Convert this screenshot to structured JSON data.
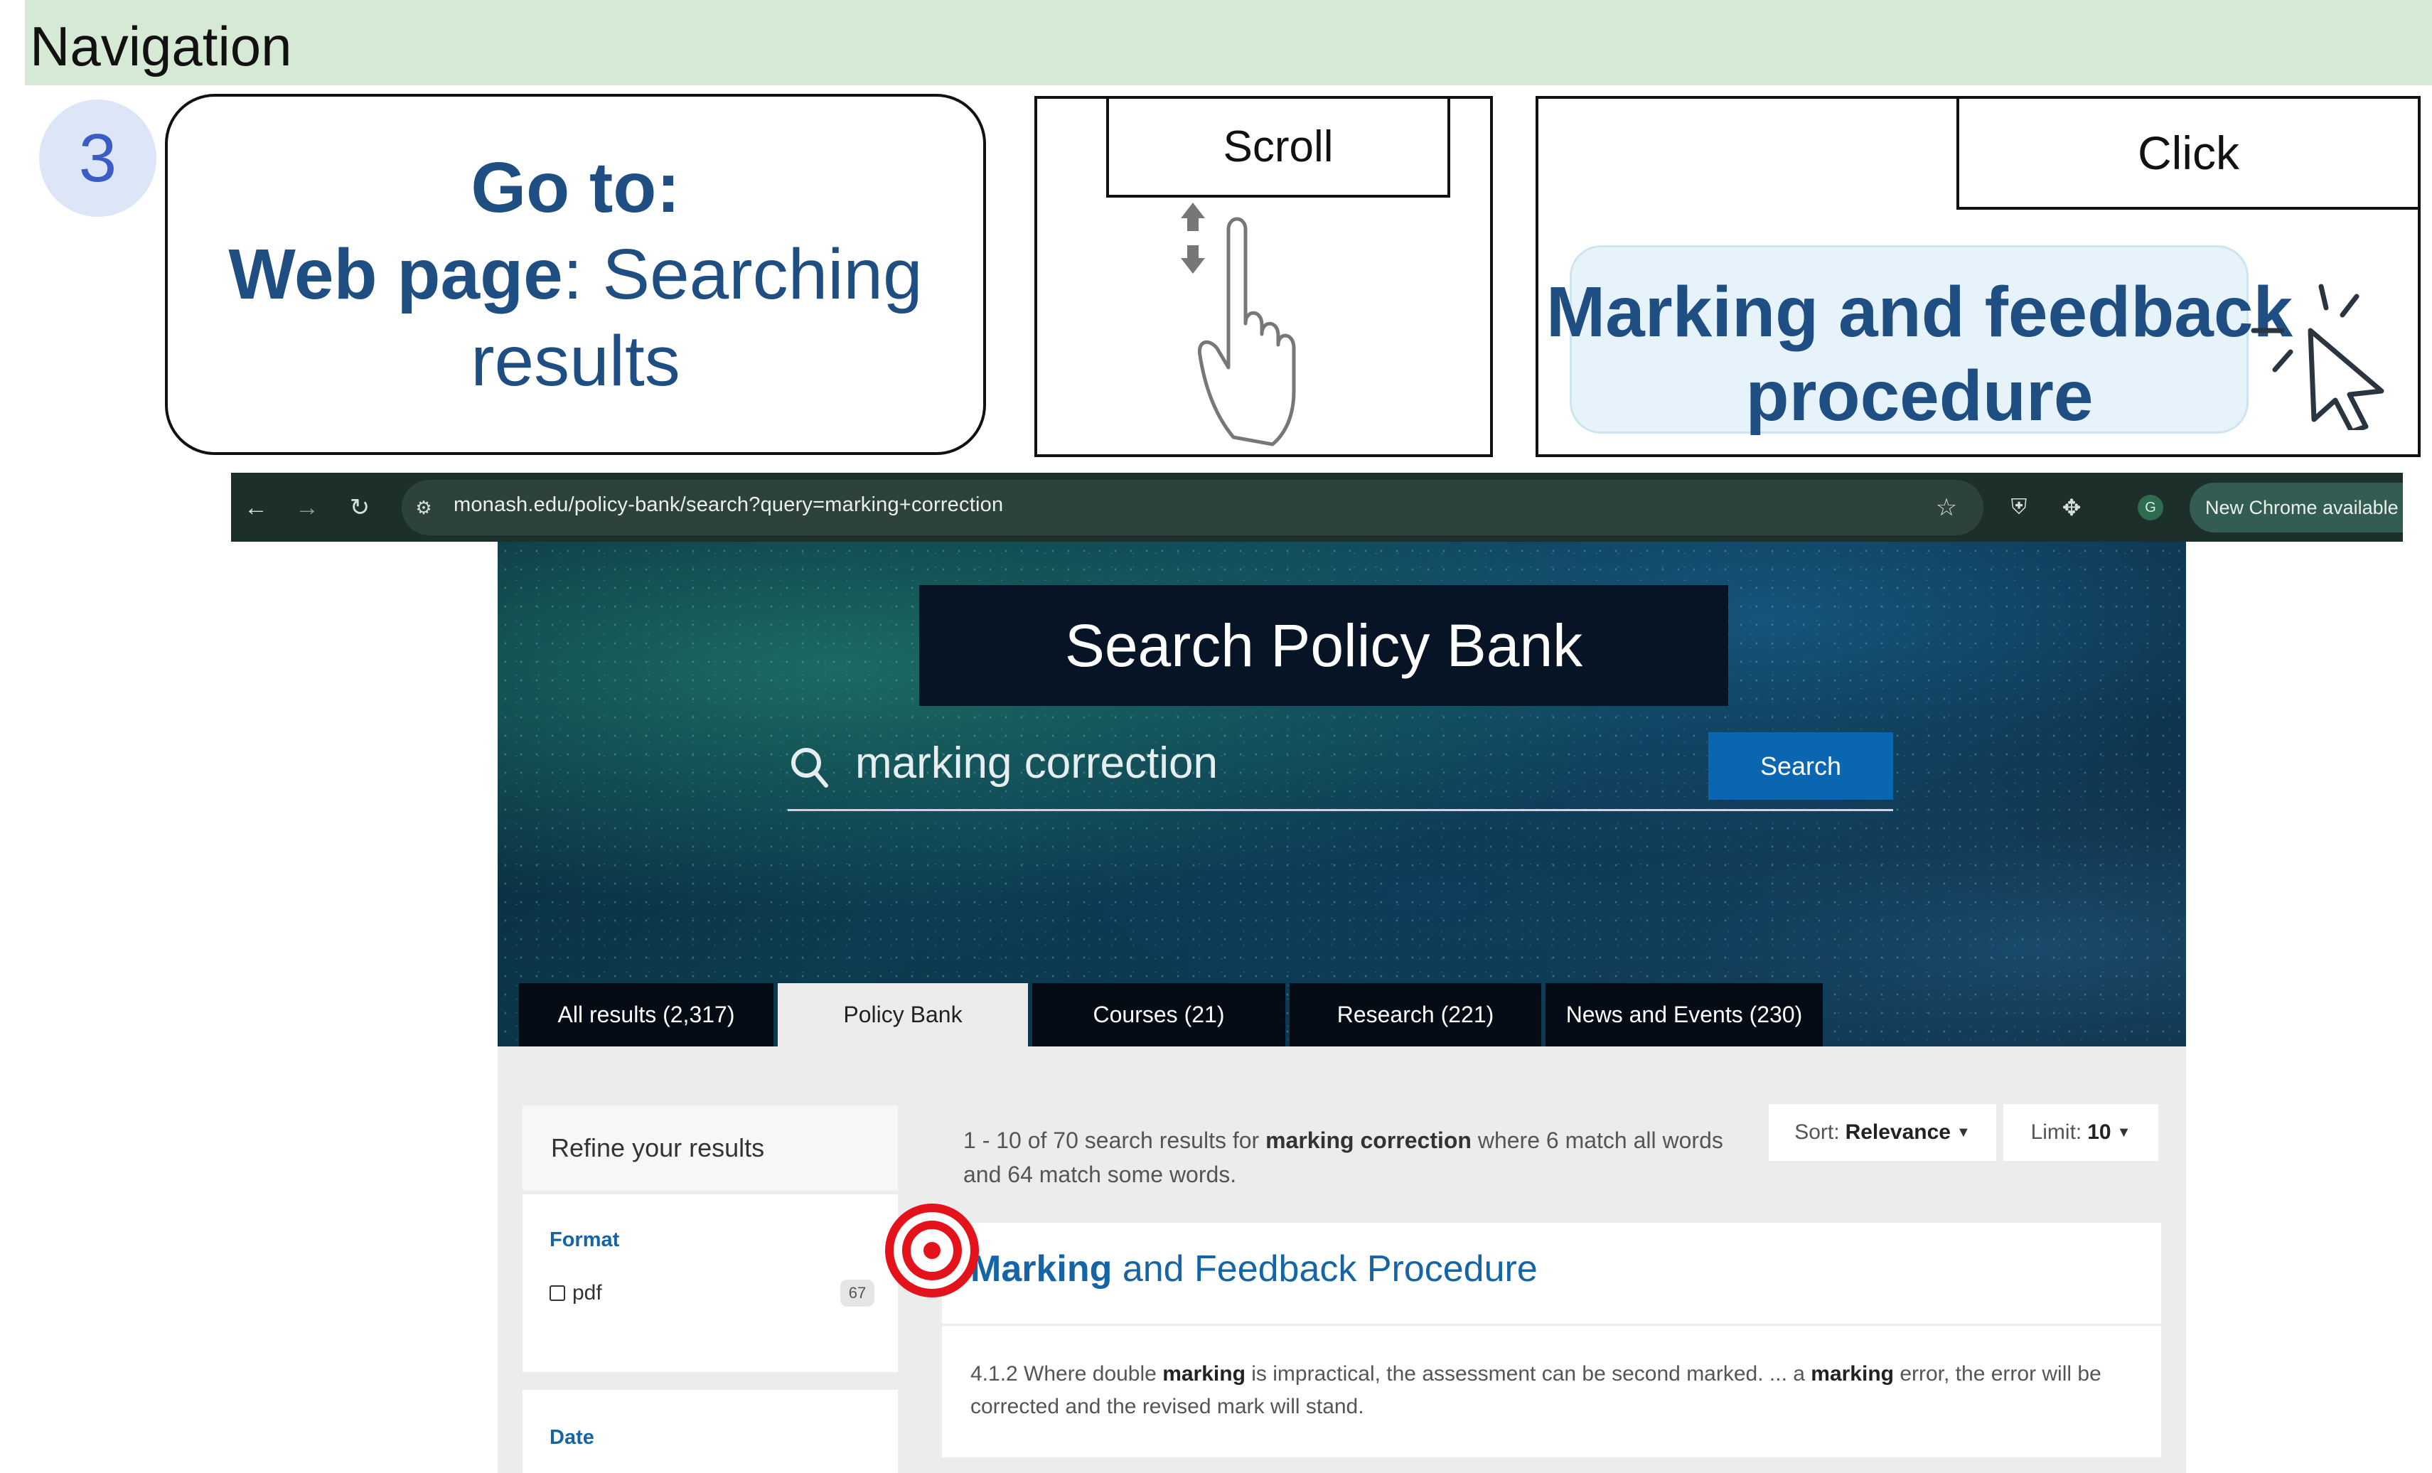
{
  "instruction_panel": {
    "section_title": "Navigation",
    "step_number": "3",
    "goto_prefix": "Go to:",
    "goto_target_bold": "Web page",
    "goto_target_rest": ": Searching results",
    "scroll_label": "Scroll",
    "click_label": "Click",
    "click_target": "Marking and feedback procedure"
  },
  "browser": {
    "url": "monash.edu/policy-bank/search?query=marking+correction",
    "update_badge": "New Chrome available"
  },
  "site": {
    "hero_title": "Search Policy Bank",
    "search_query": "marking correction",
    "search_button": "Search",
    "tabs": [
      {
        "label": "All results (2,317)",
        "active": false
      },
      {
        "label": "Policy Bank",
        "active": true
      },
      {
        "label": "Courses (21)",
        "active": false
      },
      {
        "label": "Research (221)",
        "active": false
      },
      {
        "label": "News and Events (230)",
        "active": false
      }
    ],
    "refine_title": "Refine your results",
    "format_label": "Format",
    "format_option": "pdf",
    "format_count": "67",
    "date_label": "Date",
    "summary_part1": "1 - 10 of 70 search results for ",
    "summary_query": "marking correction",
    "summary_part2": " where 6 match all words and 64 match some words.",
    "sort_prefix": "Sort: ",
    "sort_value": "Relevance",
    "limit_prefix": "Limit: ",
    "limit_value": "10",
    "result": {
      "title_bold": "Marking",
      "title_rest": " and Feedback Procedure",
      "snippet_1": "4.1.2 Where double ",
      "snippet_b1": "marking",
      "snippet_2": " is impractical, the assessment can be second marked. ... a ",
      "snippet_b2": "marking",
      "snippet_3": " error, the error will be corrected and the revised mark will stand."
    }
  },
  "colors": {
    "band": "#d5e9d4",
    "heading_blue": "#1f4e82",
    "link_blue": "#1565a6",
    "target_red": "#e3121b",
    "browser_dark": "#1d2f2b"
  }
}
